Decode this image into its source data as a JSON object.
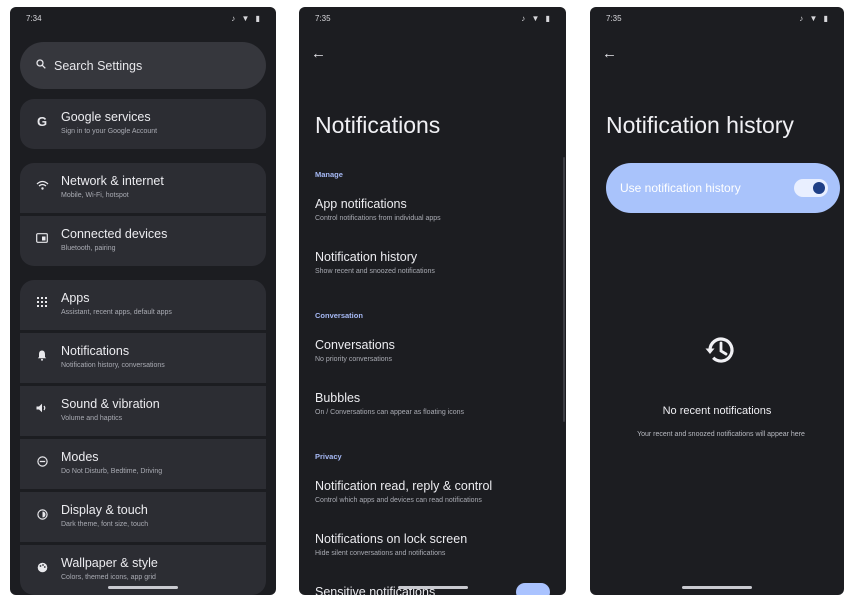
{
  "phone1": {
    "time": "7:34",
    "status_icons": "♪ ▼ ▮",
    "search_placeholder": "Search Settings",
    "items": [
      {
        "icon": "G",
        "title": "Google services",
        "subtitle": "Sign in to your Google Account"
      },
      {
        "icon": "▲",
        "title": "Network & internet",
        "subtitle": "Mobile, Wi-Fi, hotspot"
      },
      {
        "icon": "▣",
        "title": "Connected devices",
        "subtitle": "Bluetooth, pairing"
      },
      {
        "icon": "∷",
        "title": "Apps",
        "subtitle": "Assistant, recent apps, default apps"
      },
      {
        "icon": "▲",
        "title": "Notifications",
        "subtitle": "Notification history, conversations"
      },
      {
        "icon": "◀",
        "title": "Sound & vibration",
        "subtitle": "Volume and haptics"
      },
      {
        "icon": "⊝",
        "title": "Modes",
        "subtitle": "Do Not Disturb, Bedtime, Driving"
      },
      {
        "icon": "◐",
        "title": "Display & touch",
        "subtitle": "Dark theme, font size, touch"
      },
      {
        "icon": "✿",
        "title": "Wallpaper & style",
        "subtitle": "Colors, themed icons, app grid"
      }
    ]
  },
  "phone2": {
    "time": "7:35",
    "status_icons": "♪ ▼ ▮",
    "back": "←",
    "title": "Notifications",
    "sections": {
      "manage": "Manage",
      "conversation": "Conversation",
      "privacy": "Privacy"
    },
    "prefs": [
      {
        "title": "App notifications",
        "subtitle": "Control notifications from individual apps"
      },
      {
        "title": "Notification history",
        "subtitle": "Show recent and snoozed notifications"
      },
      {
        "title": "Conversations",
        "subtitle": "No priority conversations"
      },
      {
        "title": "Bubbles",
        "subtitle": "On / Conversations can appear as floating icons"
      },
      {
        "title": "Notification read, reply & control",
        "subtitle": "Control which apps and devices can read notifications"
      },
      {
        "title": "Notifications on lock screen",
        "subtitle": "Hide silent conversations and notifications"
      },
      {
        "title": "Sensitive notifications",
        "subtitle": ""
      }
    ]
  },
  "phone3": {
    "time": "7:35",
    "status_icons": "♪ ▼ ▮",
    "back": "←",
    "title": "Notification history",
    "toggle_label": "Use notification history",
    "toggle_on": true,
    "empty_title": "No recent notifications",
    "empty_subtitle": "Your recent and snoozed notifications will appear here"
  },
  "colors": {
    "background": "#1c1d21",
    "card": "#2c2d33",
    "accent": "#a9c3fb"
  }
}
